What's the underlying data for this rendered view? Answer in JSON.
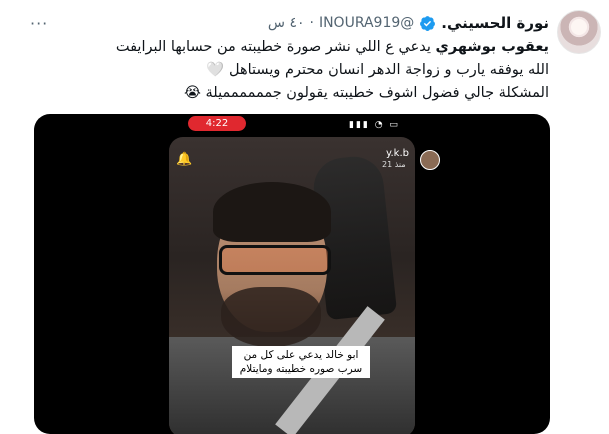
{
  "tweet": {
    "name": "نورة الحسيني.",
    "handle": "@INOURA919",
    "dot": "·",
    "time": "٤٠ س",
    "more": "···",
    "text": {
      "line1_bold": "يعقوب بوشهري",
      "line1_rest": " يدعي ع اللي نشر صورة خطيبته من حسابها البرايفت",
      "line2": "الله يوفقه يارب و زواجة الدهر انسان محترم ويستاهل 🤍",
      "line3": "المشكلة جالي فضول اشوف خطيبته يقولون جمممممميلة 😭"
    }
  },
  "video": {
    "rec_time": "4:22",
    "story_user": "y.k.b",
    "story_meta": "منذ 21",
    "caption": "ابو خالد يدعي على كل من سرب صوره خطيبته ومايتلام"
  }
}
